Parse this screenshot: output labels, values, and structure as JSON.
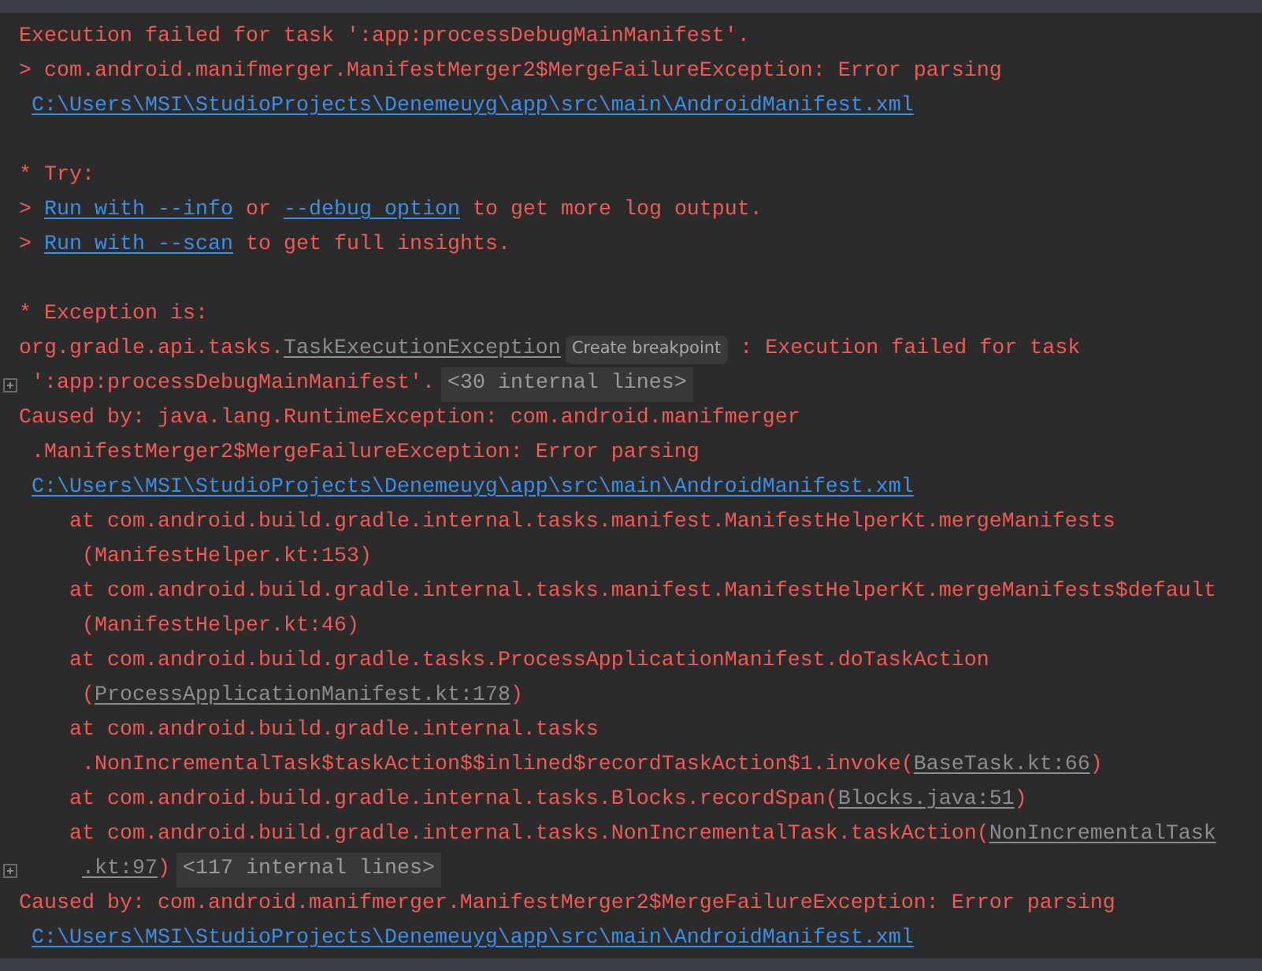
{
  "console": {
    "lines": [
      {
        "kind": "plain",
        "gutter": false,
        "segments": [
          {
            "kind": "text",
            "text": "Execution failed for task ':app:processDebugMainManifest'."
          }
        ]
      },
      {
        "kind": "plain",
        "gutter": false,
        "segments": [
          {
            "kind": "text",
            "text": "> com.android.manifmerger.ManifestMerger2$MergeFailureException: Error parsing"
          }
        ]
      },
      {
        "kind": "wrap",
        "gutter": false,
        "segments": [
          {
            "kind": "link",
            "text": "C:\\Users\\MSI\\StudioProjects\\Denemeuyg\\app\\src\\main\\AndroidManifest.xml"
          }
        ]
      },
      {
        "kind": "blank",
        "gutter": false
      },
      {
        "kind": "plain",
        "gutter": false,
        "segments": [
          {
            "kind": "text",
            "text": "* Try:"
          }
        ]
      },
      {
        "kind": "plain",
        "gutter": false,
        "segments": [
          {
            "kind": "text",
            "text": "> "
          },
          {
            "kind": "link",
            "text": "Run with --info"
          },
          {
            "kind": "text",
            "text": " or "
          },
          {
            "kind": "link",
            "text": "--debug option"
          },
          {
            "kind": "text",
            "text": " to get more log output."
          }
        ]
      },
      {
        "kind": "plain",
        "gutter": false,
        "segments": [
          {
            "kind": "text",
            "text": "> "
          },
          {
            "kind": "link",
            "text": "Run with --scan"
          },
          {
            "kind": "text",
            "text": " to get full insights."
          }
        ]
      },
      {
        "kind": "blank",
        "gutter": false
      },
      {
        "kind": "plain",
        "gutter": false,
        "segments": [
          {
            "kind": "text",
            "text": "* Exception is:"
          }
        ]
      },
      {
        "kind": "plain",
        "gutter": false,
        "segments": [
          {
            "kind": "text",
            "text": "org.gradle.api.tasks."
          },
          {
            "kind": "source",
            "text": "TaskExecutionException"
          },
          {
            "kind": "hint",
            "text": "Create breakpoint"
          },
          {
            "kind": "text",
            "text": " : Execution failed for task"
          }
        ]
      },
      {
        "kind": "wrap",
        "gutter": true,
        "segments": [
          {
            "kind": "text",
            "text": "':app:processDebugMainManifest'."
          },
          {
            "kind": "fold",
            "text": "<30 internal lines>"
          }
        ]
      },
      {
        "kind": "plain",
        "gutter": false,
        "segments": [
          {
            "kind": "text",
            "text": "Caused by: java.lang.RuntimeException: com.android.manifmerger"
          }
        ]
      },
      {
        "kind": "wrap",
        "gutter": false,
        "segments": [
          {
            "kind": "text",
            "text": ".ManifestMerger2$MergeFailureException: Error parsing"
          }
        ]
      },
      {
        "kind": "wrap",
        "gutter": false,
        "segments": [
          {
            "kind": "link",
            "text": "C:\\Users\\MSI\\StudioProjects\\Denemeuyg\\app\\src\\main\\AndroidManifest.xml"
          }
        ]
      },
      {
        "kind": "frame",
        "gutter": false,
        "segments": [
          {
            "kind": "text",
            "text": "at com.android.build.gradle.internal.tasks.manifest.ManifestHelperKt.mergeManifests"
          }
        ]
      },
      {
        "kind": "frame-wrap",
        "gutter": false,
        "segments": [
          {
            "kind": "text",
            "text": "(ManifestHelper.kt:153)"
          }
        ]
      },
      {
        "kind": "frame",
        "gutter": false,
        "segments": [
          {
            "kind": "text",
            "text": "at com.android.build.gradle.internal.tasks.manifest.ManifestHelperKt.mergeManifests$default"
          }
        ]
      },
      {
        "kind": "frame-wrap",
        "gutter": false,
        "segments": [
          {
            "kind": "text",
            "text": "(ManifestHelper.kt:46)"
          }
        ]
      },
      {
        "kind": "frame",
        "gutter": false,
        "segments": [
          {
            "kind": "text",
            "text": "at com.android.build.gradle.tasks.ProcessApplicationManifest.doTaskAction"
          }
        ]
      },
      {
        "kind": "frame-wrap",
        "gutter": false,
        "segments": [
          {
            "kind": "text",
            "text": "("
          },
          {
            "kind": "source",
            "text": "ProcessApplicationManifest.kt:178"
          },
          {
            "kind": "text",
            "text": ")"
          }
        ]
      },
      {
        "kind": "frame",
        "gutter": false,
        "segments": [
          {
            "kind": "text",
            "text": "at com.android.build.gradle.internal.tasks"
          }
        ]
      },
      {
        "kind": "frame-wrap",
        "gutter": false,
        "segments": [
          {
            "kind": "text",
            "text": ".NonIncrementalTask$taskAction$$inlined$recordTaskAction$1.invoke("
          },
          {
            "kind": "source",
            "text": "BaseTask.kt:66"
          },
          {
            "kind": "text",
            "text": ")"
          }
        ]
      },
      {
        "kind": "frame",
        "gutter": false,
        "segments": [
          {
            "kind": "text",
            "text": "at com.android.build.gradle.internal.tasks.Blocks.recordSpan("
          },
          {
            "kind": "source",
            "text": "Blocks.java:51"
          },
          {
            "kind": "text",
            "text": ")"
          }
        ]
      },
      {
        "kind": "frame",
        "gutter": false,
        "segments": [
          {
            "kind": "text",
            "text": "at com.android.build.gradle.internal.tasks.NonIncrementalTask.taskAction("
          },
          {
            "kind": "source",
            "text": "NonIncrementalTask"
          }
        ]
      },
      {
        "kind": "frame-wrap",
        "gutter": true,
        "segments": [
          {
            "kind": "source",
            "text": ".kt:97"
          },
          {
            "kind": "text",
            "text": ")"
          },
          {
            "kind": "fold",
            "text": "<117 internal lines>"
          }
        ]
      },
      {
        "kind": "plain",
        "gutter": false,
        "segments": [
          {
            "kind": "text",
            "text": "Caused by: com.android.manifmerger.ManifestMerger2$MergeFailureException: Error parsing"
          }
        ]
      },
      {
        "kind": "wrap",
        "gutter": false,
        "segments": [
          {
            "kind": "link",
            "text": "C:\\Users\\MSI\\StudioProjects\\Denemeuyg\\app\\src\\main\\AndroidManifest.xml"
          }
        ]
      }
    ]
  }
}
